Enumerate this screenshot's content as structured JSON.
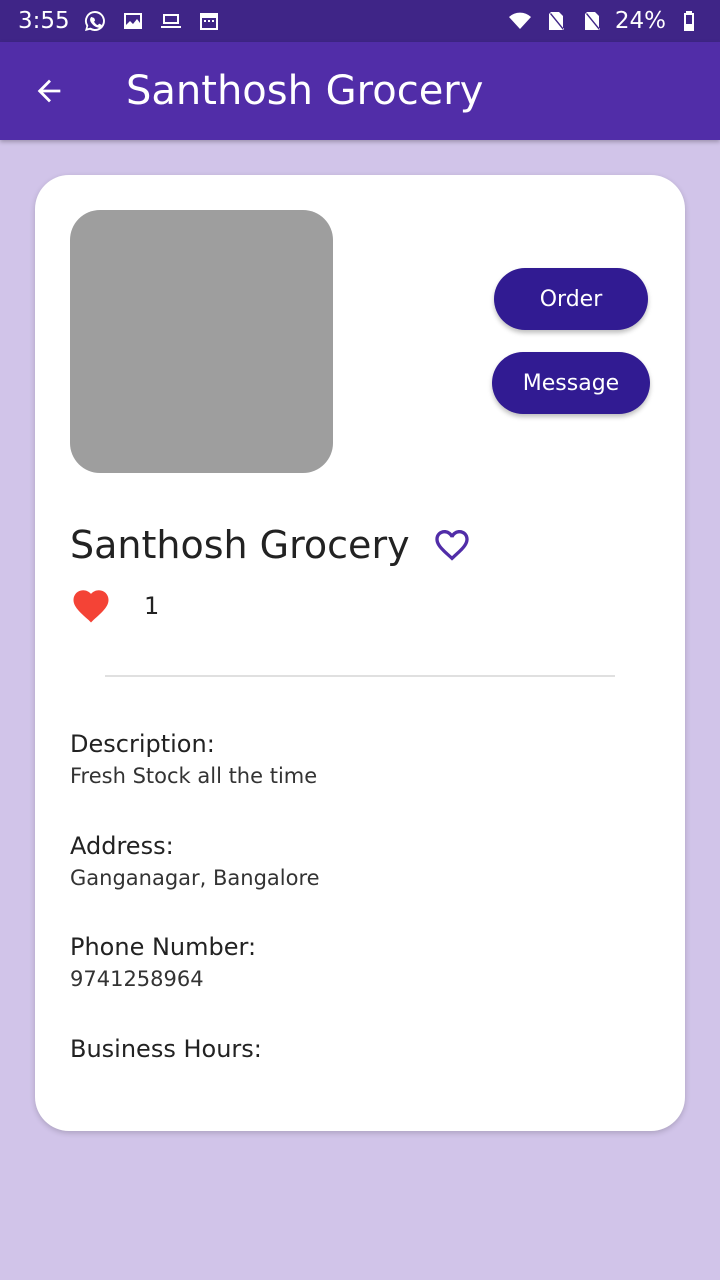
{
  "status_bar": {
    "time": "3:55",
    "battery": "24%",
    "left_icons": [
      "whatsapp-icon",
      "image-icon",
      "laptop-icon",
      "calendar-icon"
    ],
    "right_icons": [
      "wifi-icon",
      "no-sim-icon",
      "no-sim-icon",
      "battery-icon"
    ]
  },
  "app_bar": {
    "title": "Santhosh Grocery",
    "back_icon": "arrow-back-icon",
    "background": "#512da8"
  },
  "shop": {
    "name": "Santhosh Grocery",
    "like_count": "1",
    "image_placeholder_color": "#9e9e9e"
  },
  "actions": {
    "order_label": "Order",
    "message_label": "Message",
    "button_color": "#311b92"
  },
  "details": {
    "description_label": "Description:",
    "description_value": "Fresh Stock all the time",
    "address_label": "Address:",
    "address_value": "Ganganagar, Bangalore",
    "phone_label": "Phone Number:",
    "phone_value": "9741258964",
    "hours_label": "Business Hours:"
  },
  "colors": {
    "page_background": "#d1c4e9",
    "status_bar": "#3f2587",
    "heart_filled": "#f44336"
  }
}
